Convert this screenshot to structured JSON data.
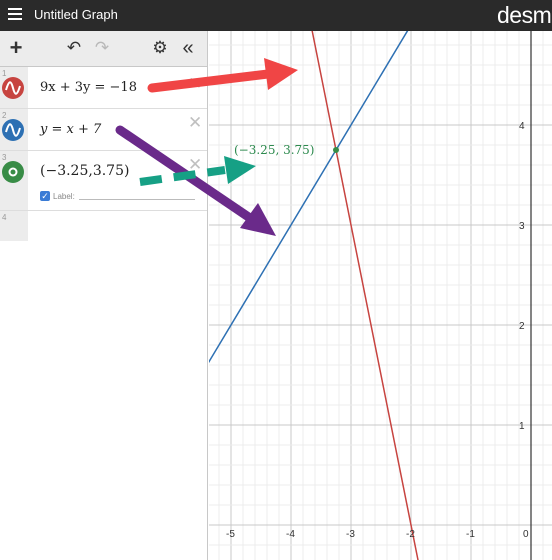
{
  "app": {
    "title": "Untitled Graph",
    "brand": "desm"
  },
  "toolbar": {
    "add": "+",
    "undo": "↶",
    "redo": "↷",
    "settings": "⚙",
    "collapse": "«"
  },
  "expressions": [
    {
      "index": "1",
      "latex": "9x + 3y = −18",
      "color": "#c74440",
      "icon": "wave-icon"
    },
    {
      "index": "2",
      "latex": "y = x + 7",
      "color": "#2d70b3",
      "icon": "wave-icon"
    },
    {
      "index": "3",
      "latex": "(−3.25,3.75)",
      "color": "#388c46",
      "icon": "point-icon",
      "label_checkbox": "Label:"
    },
    {
      "index": "4",
      "latex": ""
    }
  ],
  "graph": {
    "x_ticks": [
      "-5",
      "-4",
      "-3",
      "-2",
      "-1",
      "0"
    ],
    "y_ticks": [
      "1",
      "2",
      "3",
      "4"
    ],
    "point_label": "(−3.25, 3.75)",
    "point": {
      "x": -3.25,
      "y": 3.75
    },
    "line1_color": "#c74440",
    "line2_color": "#2d70b3",
    "point_color": "#388c46"
  },
  "annotations": {
    "red_arrow_color": "#f04545",
    "purple_arrow_color": "#6a2a8a",
    "teal_arrow_color": "#16a085"
  }
}
